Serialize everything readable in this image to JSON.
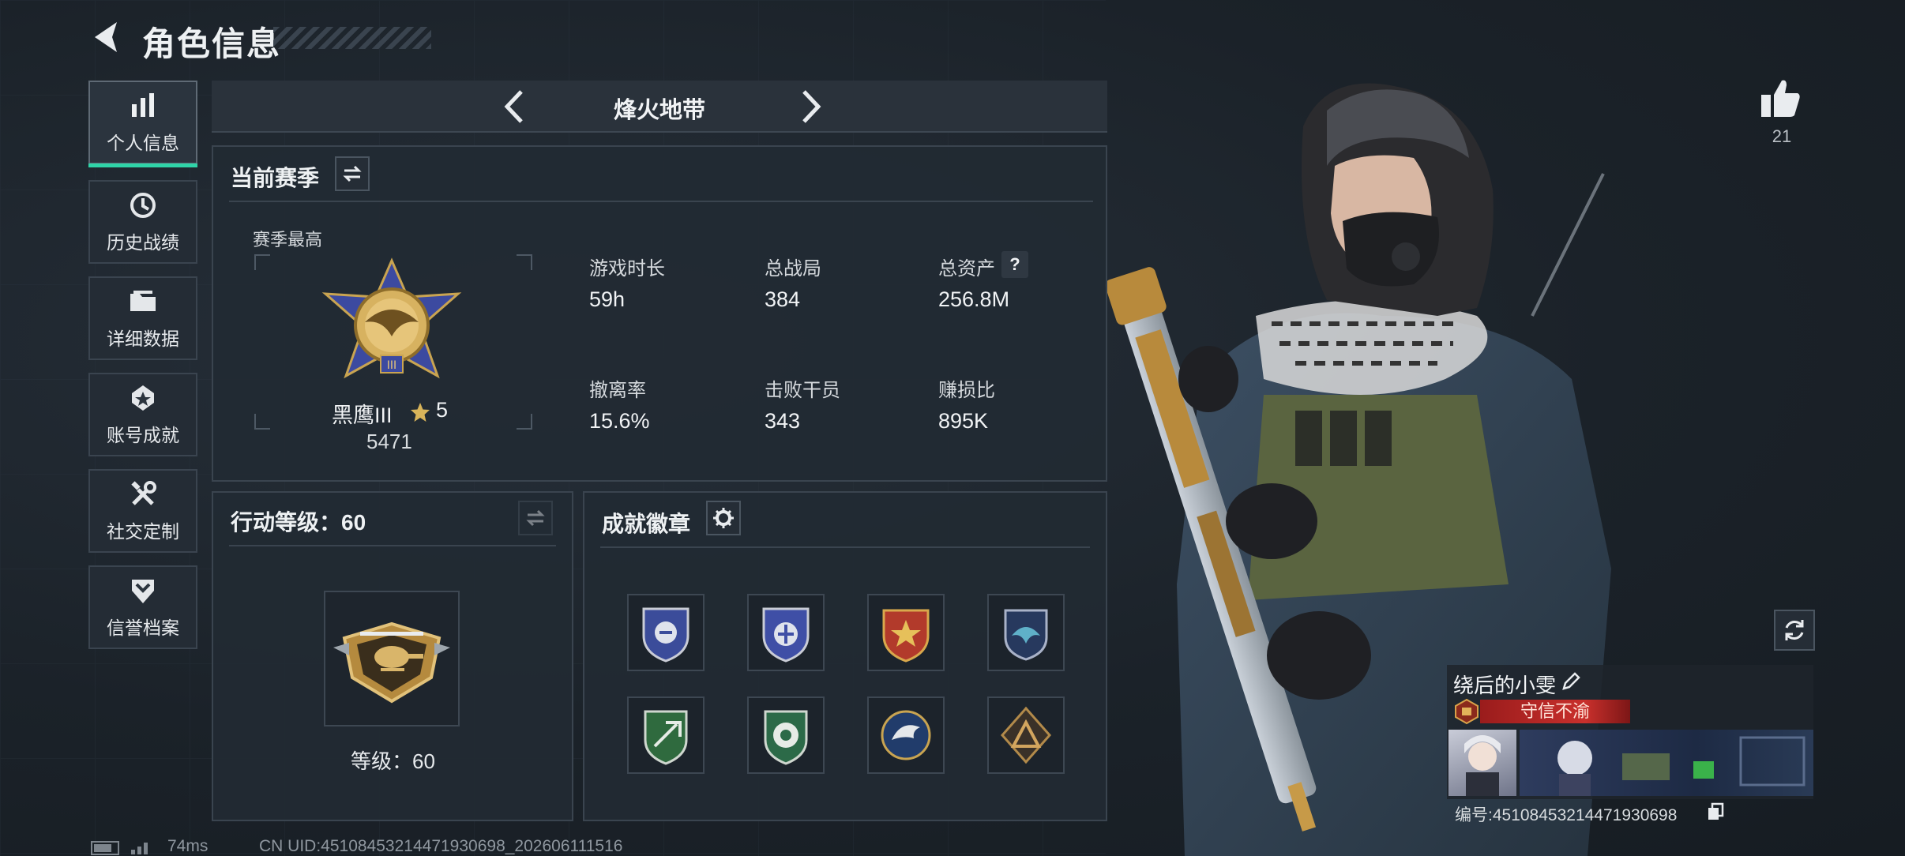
{
  "header": {
    "title": "角色信息"
  },
  "sidebar": {
    "items": [
      {
        "label": "个人信息",
        "icon": "bar-chart-icon",
        "active": true
      },
      {
        "label": "历史战绩",
        "icon": "history-icon"
      },
      {
        "label": "详细数据",
        "icon": "folder-icon"
      },
      {
        "label": "账号成就",
        "icon": "achievement-icon"
      },
      {
        "label": "社交定制",
        "icon": "tools-icon"
      },
      {
        "label": "信誉档案",
        "icon": "shield-chevron-icon"
      }
    ]
  },
  "mode": {
    "name": "烽火地带"
  },
  "season": {
    "title": "当前赛季",
    "best_label": "赛季最高",
    "rank_name": "黑鹰III",
    "stars": "5",
    "points": "5471",
    "stats": [
      {
        "label": "游戏时长",
        "value": "59h"
      },
      {
        "label": "总战局",
        "value": "384"
      },
      {
        "label": "总资产",
        "value": "256.8M",
        "help": "?"
      },
      {
        "label": "撤离率",
        "value": "15.6%"
      },
      {
        "label": "击败干员",
        "value": "343"
      },
      {
        "label": "赚损比",
        "value": "895K"
      }
    ]
  },
  "action_level": {
    "title": "行动等级：60",
    "level_text": "等级：60"
  },
  "badges": {
    "title": "成就徽章",
    "items": [
      "blue-shield-badge",
      "blue-shield-badge-2",
      "red-star-badge",
      "navy-eagle-badge",
      "green-shield-badge",
      "green-flower-badge",
      "eagle-head-badge",
      "bronze-triangle-badge"
    ]
  },
  "profile": {
    "likes": "21",
    "player_name": "绕后的小雯",
    "title_badge": "守信不渝",
    "id_line": "编号:45108453214471930698"
  },
  "status_bar": {
    "ping": "74ms",
    "uid": "CN UID:45108453214471930698_202606111516"
  },
  "colors": {
    "accent": "#2fd4a8",
    "panel": "#222a33",
    "title_red": "#c9302c"
  }
}
